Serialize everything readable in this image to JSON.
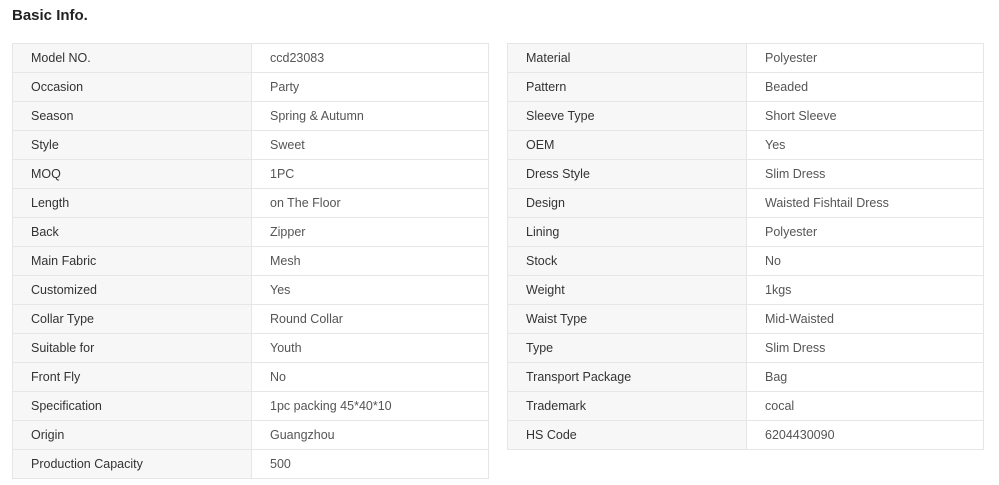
{
  "section": {
    "title": "Basic Info."
  },
  "left_table": [
    {
      "label": "Model NO.",
      "value": "ccd23083"
    },
    {
      "label": "Occasion",
      "value": "Party"
    },
    {
      "label": "Season",
      "value": "Spring & Autumn"
    },
    {
      "label": "Style",
      "value": "Sweet"
    },
    {
      "label": "MOQ",
      "value": "1PC"
    },
    {
      "label": "Length",
      "value": "on The Floor"
    },
    {
      "label": "Back",
      "value": "Zipper"
    },
    {
      "label": "Main Fabric",
      "value": "Mesh"
    },
    {
      "label": "Customized",
      "value": "Yes"
    },
    {
      "label": "Collar Type",
      "value": "Round Collar"
    },
    {
      "label": "Suitable for",
      "value": "Youth"
    },
    {
      "label": "Front Fly",
      "value": "No"
    },
    {
      "label": "Specification",
      "value": "1pc packing 45*40*10"
    },
    {
      "label": "Origin",
      "value": "Guangzhou"
    },
    {
      "label": "Production Capacity",
      "value": "500"
    }
  ],
  "right_table": [
    {
      "label": "Material",
      "value": "Polyester"
    },
    {
      "label": "Pattern",
      "value": "Beaded"
    },
    {
      "label": "Sleeve Type",
      "value": "Short Sleeve"
    },
    {
      "label": "OEM",
      "value": "Yes"
    },
    {
      "label": "Dress Style",
      "value": "Slim Dress"
    },
    {
      "label": "Design",
      "value": "Waisted Fishtail Dress"
    },
    {
      "label": "Lining",
      "value": "Polyester"
    },
    {
      "label": "Stock",
      "value": "No"
    },
    {
      "label": "Weight",
      "value": "1kgs"
    },
    {
      "label": "Waist Type",
      "value": "Mid-Waisted"
    },
    {
      "label": "Type",
      "value": "Slim Dress"
    },
    {
      "label": "Transport Package",
      "value": "Bag"
    },
    {
      "label": "Trademark",
      "value": "cocal"
    },
    {
      "label": "HS Code",
      "value": "6204430090"
    }
  ]
}
